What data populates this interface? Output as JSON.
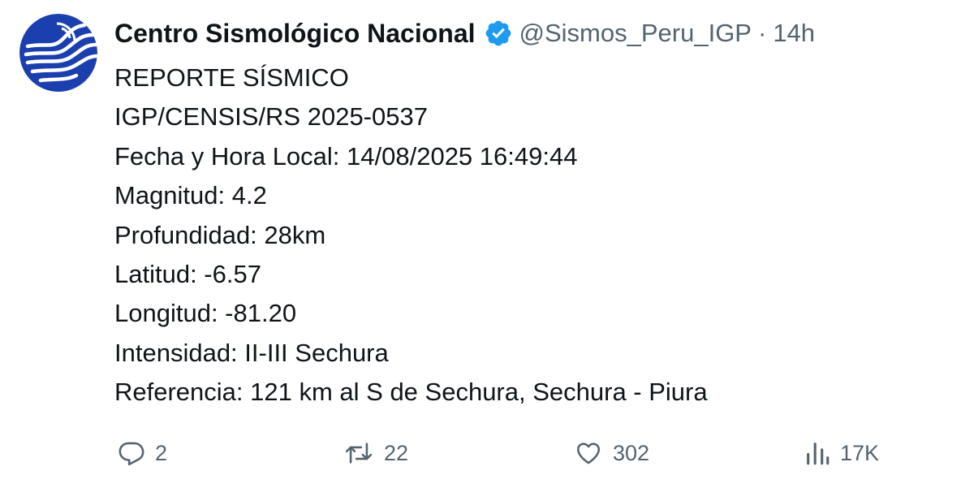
{
  "author": {
    "name": "Centro Sismológico Nacional",
    "handle": "@Sismos_Peru_IGP",
    "separator": "·",
    "time": "14h"
  },
  "tweet_lines": [
    "REPORTE SÍSMICO",
    "IGP/CENSIS/RS 2025-0537",
    "Fecha y Hora Local: 14/08/2025 16:49:44",
    "Magnitud: 4.2",
    "Profundidad: 28km",
    "Latitud: -6.57",
    "Longitud: -81.20",
    "Intensidad: II-III Sechura",
    "Referencia: 121 km al S de Sechura, Sechura - Piura"
  ],
  "actions": {
    "replies": "2",
    "reposts": "22",
    "likes": "302",
    "views": "17K"
  },
  "icons": {
    "avatar": "seismic-wave-logo",
    "verified": "verified-badge-icon",
    "reply": "reply-icon",
    "repost": "repost-icon",
    "like": "heart-icon",
    "views": "views-icon"
  },
  "colors": {
    "text": "#0f1419",
    "secondary": "#536471",
    "verified": "#1d9bf0",
    "avatar_blue": "#1b3fae"
  }
}
